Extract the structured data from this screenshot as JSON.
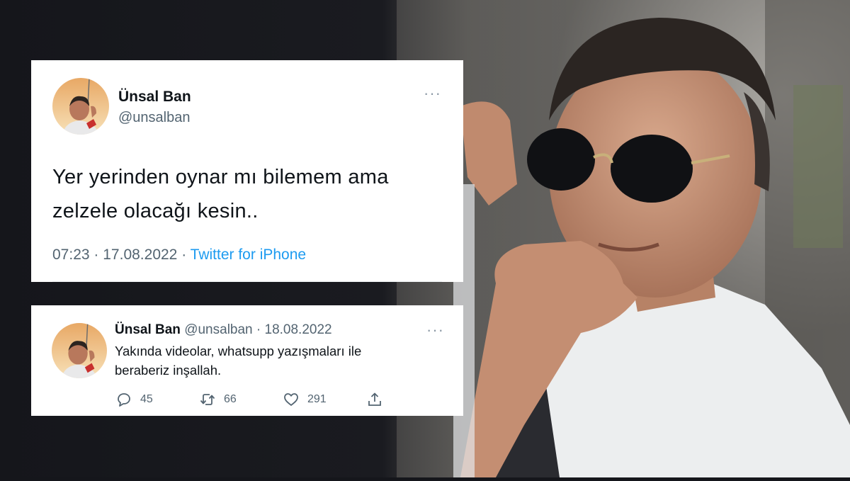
{
  "colors": {
    "background": "#15161b",
    "card": "#ffffff",
    "text": "#0f1419",
    "muted": "#536471",
    "link": "#1d9bf0"
  },
  "tweet_main": {
    "display_name": "Ünsal Ban",
    "handle": "@unsalban",
    "text_line1": "Yer yerinden oynar mı bilemem ama",
    "text_line2": "zelzele olacağı kesin..",
    "time": "07:23",
    "date": "17.08.2022",
    "separator": "·",
    "source": "Twitter for iPhone",
    "more_icon": "more-horizontal-icon"
  },
  "tweet_reply": {
    "display_name": "Ünsal Ban",
    "handle": "@unsalban",
    "separator": "·",
    "date": "18.08.2022",
    "text_line1": "Yakında videolar, whatsupp yazışmaları ile",
    "text_line2": "beraberiz inşallah.",
    "replies": "45",
    "retweets": "66",
    "likes": "291",
    "icons": [
      "reply-icon",
      "retweet-icon",
      "like-icon",
      "share-icon"
    ]
  }
}
